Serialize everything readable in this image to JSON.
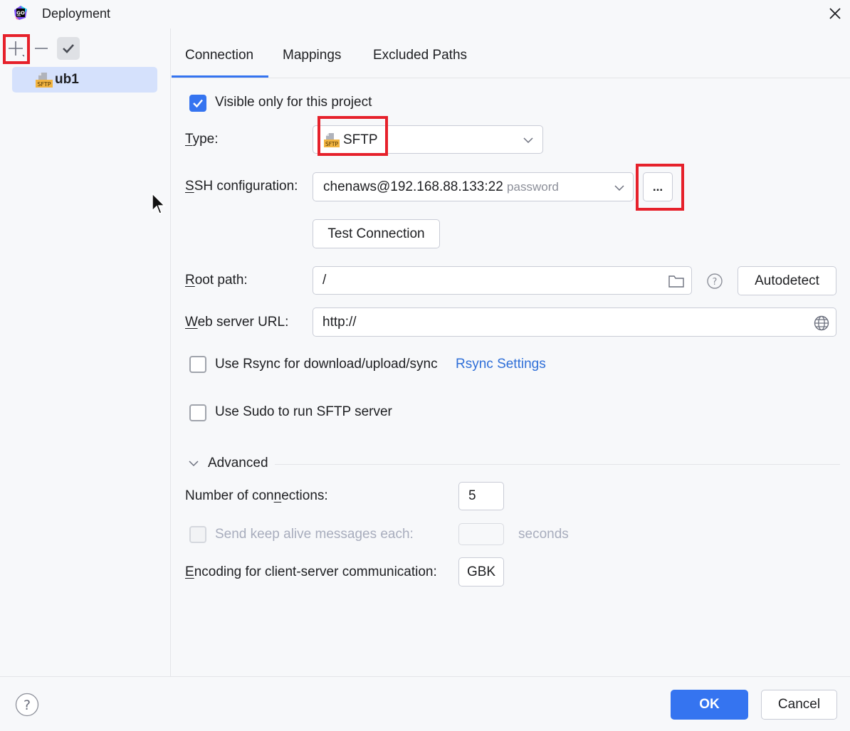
{
  "window": {
    "title": "Deployment",
    "app_icon": "goland-logo-icon"
  },
  "sidebar": {
    "toolbar": [
      "add-icon",
      "remove-icon",
      "check-icon"
    ],
    "servers": [
      {
        "label": "ub1",
        "icon_text": "SFTP"
      }
    ]
  },
  "tabs": [
    {
      "label": "Connection",
      "selected": true
    },
    {
      "label": "Mappings",
      "selected": false
    },
    {
      "label": "Excluded Paths",
      "selected": false
    }
  ],
  "connection": {
    "visible_only": {
      "label": "Visible only for this project",
      "checked": true
    },
    "type": {
      "label_first": "T",
      "label_rest": "ype:",
      "value": "SFTP",
      "icon_text": "SFTP"
    },
    "ssh": {
      "label_first": "S",
      "label_rest": "SH configuration:",
      "value": "chenaws@192.168.88.133:22",
      "hint": "password",
      "more_button": "..."
    },
    "test_connection": "Test Connection",
    "root_path": {
      "label_first": "R",
      "label_rest": "oot path:",
      "value": "/",
      "autodetect": "Autodetect"
    },
    "web_url": {
      "label_first": "W",
      "label_rest": "eb server URL:",
      "value": "http://"
    },
    "rsync": {
      "label": "Use Rsync for download/upload/sync",
      "checked": false,
      "link": "Rsync Settings"
    },
    "sudo": {
      "label": "Use Sudo to run SFTP server",
      "checked": false
    },
    "advanced": {
      "title": "Advanced",
      "connections": {
        "label_a": "Number of con",
        "label_u": "n",
        "label_b": "ections:",
        "value": "5"
      },
      "keep_alive": {
        "label": "Send keep alive messages each:",
        "value": "",
        "unit": "seconds",
        "enabled": false
      },
      "encoding": {
        "label_first": "E",
        "label_rest": "ncoding for client-server communication:",
        "value": "GBK"
      }
    }
  },
  "footer": {
    "ok": "OK",
    "cancel": "Cancel"
  },
  "colors": {
    "accent": "#3574f0",
    "highlight": "#e6212b",
    "selection": "#d5e1fc"
  }
}
